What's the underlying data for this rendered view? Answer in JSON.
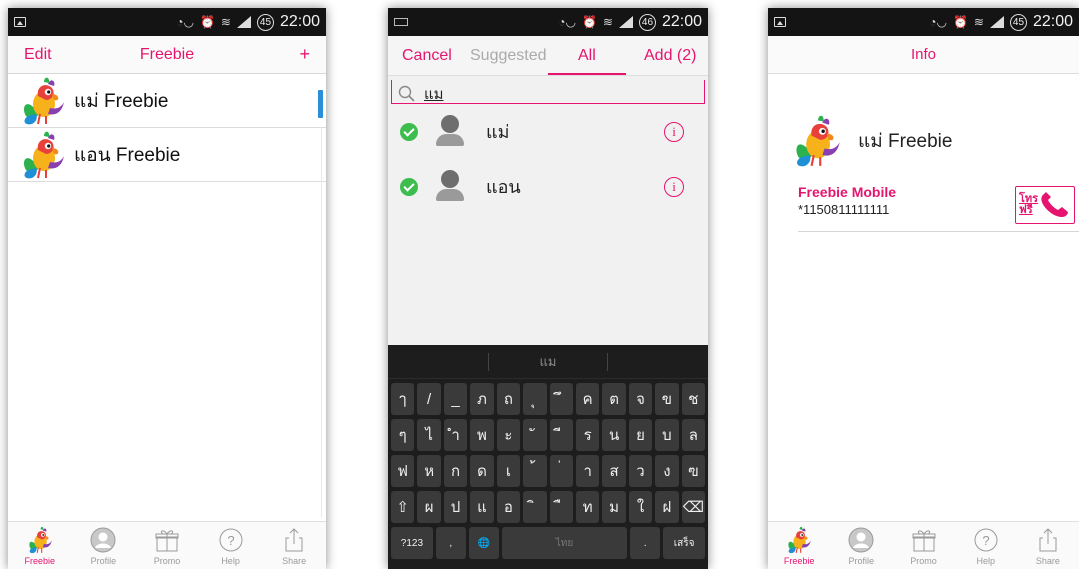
{
  "status": {
    "time": "22:00",
    "battery1": "45",
    "battery2": "46",
    "battery3": "45"
  },
  "screen1": {
    "nav": {
      "left": "Edit",
      "title": "Freebie",
      "right": "+"
    },
    "contacts": [
      {
        "name": "แม่ Freebie"
      },
      {
        "name": "แอน Freebie"
      }
    ]
  },
  "screen2": {
    "tabs": {
      "cancel": "Cancel",
      "suggested": "Suggested",
      "all": "All",
      "add": "Add (2)"
    },
    "search": {
      "value": "แม"
    },
    "contacts": [
      {
        "name": "แม่"
      },
      {
        "name": "แอน"
      }
    ],
    "keyboard": {
      "suggestion": "แม",
      "row1": [
        "ๅ",
        "/",
        "_",
        "ภ",
        "ถ",
        "ุ",
        "ึ",
        "ค",
        "ต",
        "จ",
        "ข",
        "ช"
      ],
      "row2": [
        "ๆ",
        "ไ",
        "ำ",
        "พ",
        "ะ",
        "ั",
        "ี",
        "ร",
        "น",
        "ย",
        "บ",
        "ล"
      ],
      "row3": [
        "ฟ",
        "ห",
        "ก",
        "ด",
        "เ",
        "้",
        "่",
        "า",
        "ส",
        "ว",
        "ง",
        "ฃ"
      ],
      "row4": [
        "⇧",
        "ผ",
        "ป",
        "แ",
        "อ",
        "ิ",
        "ื",
        "ท",
        "ม",
        "ใ",
        "ฝ",
        "⌫"
      ],
      "row5": {
        "sym": "?123",
        "comma": ",",
        "globe": "🌐",
        "space": "ไทย",
        "period": ".",
        "done": "เสร็จ"
      }
    }
  },
  "screen3": {
    "nav": {
      "title": "Info"
    },
    "contact": {
      "name": "แม่ Freebie"
    },
    "line": {
      "label": "Freebie Mobile",
      "number": "*1150811111111",
      "call_label_top": "โทร",
      "call_label_bottom": "ฟรี"
    }
  },
  "tabbar": [
    {
      "label": "Freebie",
      "icon": "parrot-icon"
    },
    {
      "label": "Profile",
      "icon": "profile-icon"
    },
    {
      "label": "Promo",
      "icon": "gift-icon"
    },
    {
      "label": "Help",
      "icon": "help-icon"
    },
    {
      "label": "Share",
      "icon": "share-icon"
    }
  ],
  "colors": {
    "accent": "#e5156f",
    "check": "#3ebd4f",
    "index_bar": "#2a8ed8"
  }
}
